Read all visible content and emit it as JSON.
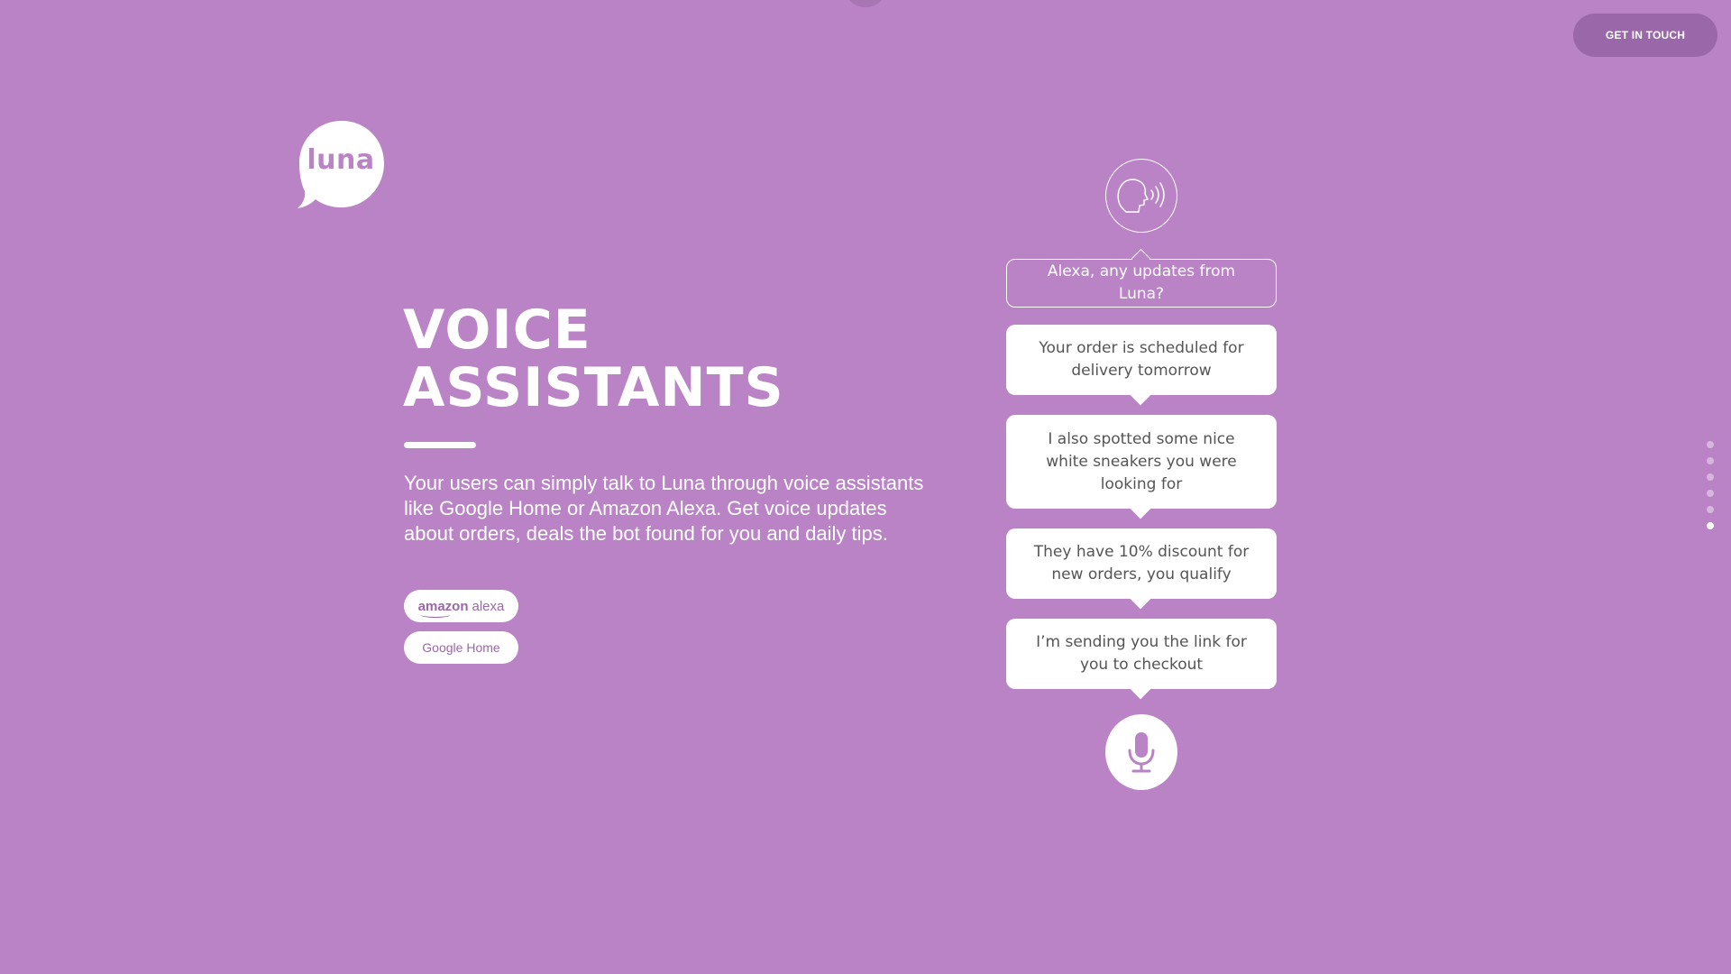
{
  "header": {
    "cta_label": "GET IN TOUCH"
  },
  "brand": {
    "logo_text": "luna"
  },
  "hero": {
    "title": "VOICE\nASSISTANTS",
    "description": "Your users can simply talk to Luna through voice assistants like Google Home or Amazon Alexa. Get voice updates about orders, deals the bot found for you and daily tips.",
    "badges": {
      "alexa_brand": "amazon",
      "alexa_product": "alexa",
      "google": "Google Home"
    }
  },
  "conversation": {
    "user_message": "Alexa, any updates from Luna?",
    "bot_messages": [
      "Your order is scheduled for delivery tomorrow",
      "I also spotted some nice white sneakers you were looking for",
      "They have 10% discount for new orders, you qualify",
      "I’m sending you the link for you to checkout"
    ],
    "icons": {
      "speaker": "speaking-head-icon",
      "mic": "microphone-icon"
    }
  },
  "pagination": {
    "total": 6,
    "active_index": 5
  },
  "colors": {
    "background": "#b983c6",
    "cta_background": "#9a67a8",
    "accent": "#ffffff",
    "bot_text": "#555555"
  }
}
